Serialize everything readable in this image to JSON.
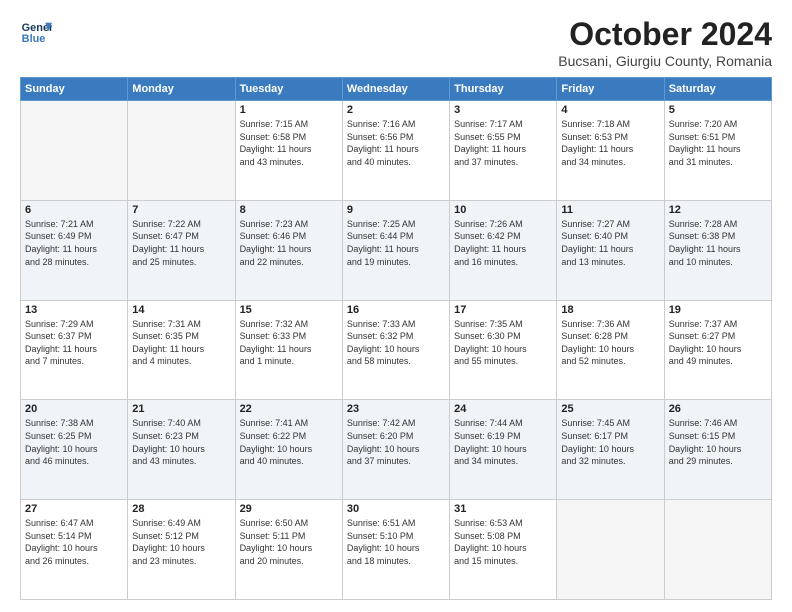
{
  "header": {
    "logo_line1": "General",
    "logo_line2": "Blue",
    "title": "October 2024",
    "subtitle": "Bucsani, Giurgiu County, Romania"
  },
  "columns": [
    "Sunday",
    "Monday",
    "Tuesday",
    "Wednesday",
    "Thursday",
    "Friday",
    "Saturday"
  ],
  "weeks": [
    [
      {
        "day": "",
        "info": ""
      },
      {
        "day": "",
        "info": ""
      },
      {
        "day": "1",
        "info": "Sunrise: 7:15 AM\nSunset: 6:58 PM\nDaylight: 11 hours\nand 43 minutes."
      },
      {
        "day": "2",
        "info": "Sunrise: 7:16 AM\nSunset: 6:56 PM\nDaylight: 11 hours\nand 40 minutes."
      },
      {
        "day": "3",
        "info": "Sunrise: 7:17 AM\nSunset: 6:55 PM\nDaylight: 11 hours\nand 37 minutes."
      },
      {
        "day": "4",
        "info": "Sunrise: 7:18 AM\nSunset: 6:53 PM\nDaylight: 11 hours\nand 34 minutes."
      },
      {
        "day": "5",
        "info": "Sunrise: 7:20 AM\nSunset: 6:51 PM\nDaylight: 11 hours\nand 31 minutes."
      }
    ],
    [
      {
        "day": "6",
        "info": "Sunrise: 7:21 AM\nSunset: 6:49 PM\nDaylight: 11 hours\nand 28 minutes."
      },
      {
        "day": "7",
        "info": "Sunrise: 7:22 AM\nSunset: 6:47 PM\nDaylight: 11 hours\nand 25 minutes."
      },
      {
        "day": "8",
        "info": "Sunrise: 7:23 AM\nSunset: 6:46 PM\nDaylight: 11 hours\nand 22 minutes."
      },
      {
        "day": "9",
        "info": "Sunrise: 7:25 AM\nSunset: 6:44 PM\nDaylight: 11 hours\nand 19 minutes."
      },
      {
        "day": "10",
        "info": "Sunrise: 7:26 AM\nSunset: 6:42 PM\nDaylight: 11 hours\nand 16 minutes."
      },
      {
        "day": "11",
        "info": "Sunrise: 7:27 AM\nSunset: 6:40 PM\nDaylight: 11 hours\nand 13 minutes."
      },
      {
        "day": "12",
        "info": "Sunrise: 7:28 AM\nSunset: 6:38 PM\nDaylight: 11 hours\nand 10 minutes."
      }
    ],
    [
      {
        "day": "13",
        "info": "Sunrise: 7:29 AM\nSunset: 6:37 PM\nDaylight: 11 hours\nand 7 minutes."
      },
      {
        "day": "14",
        "info": "Sunrise: 7:31 AM\nSunset: 6:35 PM\nDaylight: 11 hours\nand 4 minutes."
      },
      {
        "day": "15",
        "info": "Sunrise: 7:32 AM\nSunset: 6:33 PM\nDaylight: 11 hours\nand 1 minute."
      },
      {
        "day": "16",
        "info": "Sunrise: 7:33 AM\nSunset: 6:32 PM\nDaylight: 10 hours\nand 58 minutes."
      },
      {
        "day": "17",
        "info": "Sunrise: 7:35 AM\nSunset: 6:30 PM\nDaylight: 10 hours\nand 55 minutes."
      },
      {
        "day": "18",
        "info": "Sunrise: 7:36 AM\nSunset: 6:28 PM\nDaylight: 10 hours\nand 52 minutes."
      },
      {
        "day": "19",
        "info": "Sunrise: 7:37 AM\nSunset: 6:27 PM\nDaylight: 10 hours\nand 49 minutes."
      }
    ],
    [
      {
        "day": "20",
        "info": "Sunrise: 7:38 AM\nSunset: 6:25 PM\nDaylight: 10 hours\nand 46 minutes."
      },
      {
        "day": "21",
        "info": "Sunrise: 7:40 AM\nSunset: 6:23 PM\nDaylight: 10 hours\nand 43 minutes."
      },
      {
        "day": "22",
        "info": "Sunrise: 7:41 AM\nSunset: 6:22 PM\nDaylight: 10 hours\nand 40 minutes."
      },
      {
        "day": "23",
        "info": "Sunrise: 7:42 AM\nSunset: 6:20 PM\nDaylight: 10 hours\nand 37 minutes."
      },
      {
        "day": "24",
        "info": "Sunrise: 7:44 AM\nSunset: 6:19 PM\nDaylight: 10 hours\nand 34 minutes."
      },
      {
        "day": "25",
        "info": "Sunrise: 7:45 AM\nSunset: 6:17 PM\nDaylight: 10 hours\nand 32 minutes."
      },
      {
        "day": "26",
        "info": "Sunrise: 7:46 AM\nSunset: 6:15 PM\nDaylight: 10 hours\nand 29 minutes."
      }
    ],
    [
      {
        "day": "27",
        "info": "Sunrise: 6:47 AM\nSunset: 5:14 PM\nDaylight: 10 hours\nand 26 minutes."
      },
      {
        "day": "28",
        "info": "Sunrise: 6:49 AM\nSunset: 5:12 PM\nDaylight: 10 hours\nand 23 minutes."
      },
      {
        "day": "29",
        "info": "Sunrise: 6:50 AM\nSunset: 5:11 PM\nDaylight: 10 hours\nand 20 minutes."
      },
      {
        "day": "30",
        "info": "Sunrise: 6:51 AM\nSunset: 5:10 PM\nDaylight: 10 hours\nand 18 minutes."
      },
      {
        "day": "31",
        "info": "Sunrise: 6:53 AM\nSunset: 5:08 PM\nDaylight: 10 hours\nand 15 minutes."
      },
      {
        "day": "",
        "info": ""
      },
      {
        "day": "",
        "info": ""
      }
    ]
  ]
}
